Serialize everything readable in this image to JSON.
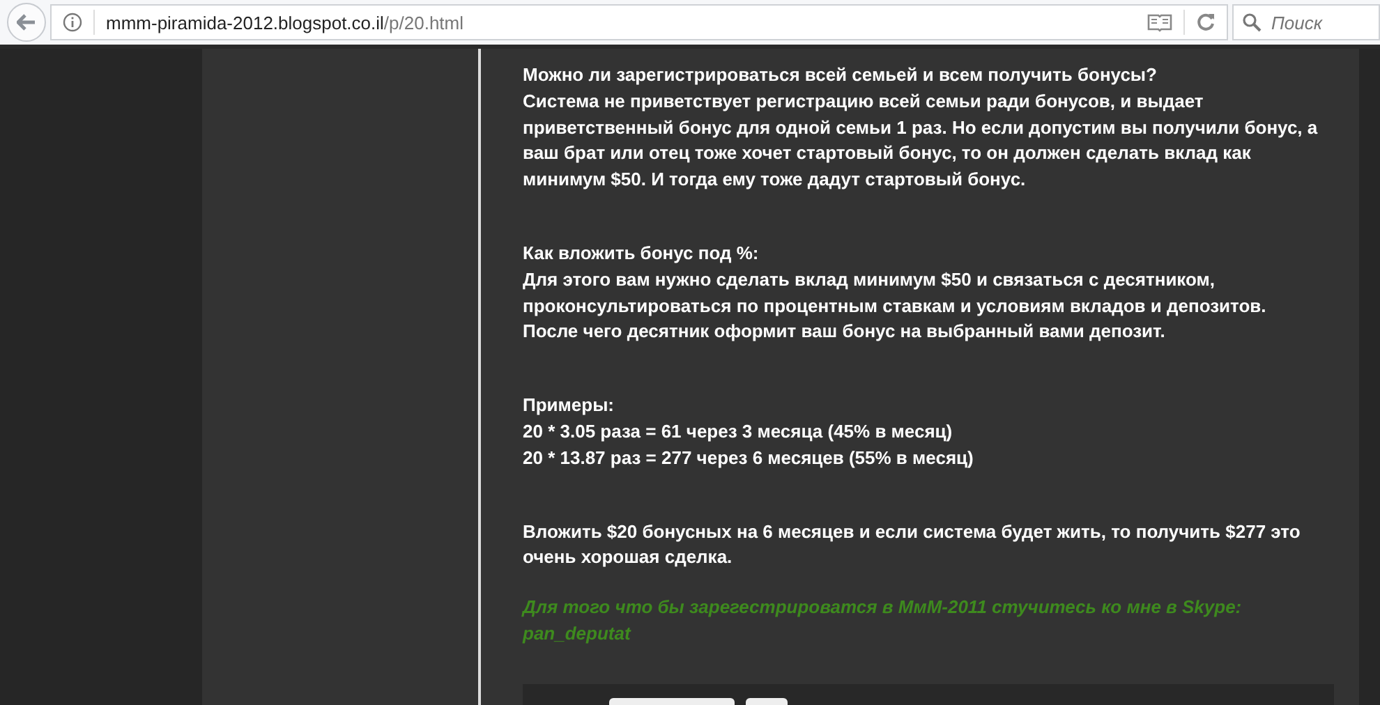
{
  "browser": {
    "url_host": "mmm-piramida-2012.blogspot.co.il",
    "url_path": "/p/20.html",
    "search": {
      "placeholder": "Поиск"
    }
  },
  "article": {
    "blocks": [
      {
        "kind": "text",
        "paragraphs": [
          "Можно ли зарегистрироваться всей семьей и всем получить бонусы?",
          "Система не приветствует регистрацию всей семьи ради бонусов, и выдает приветственный бонус для одной семьи 1 раз. Но если допустим вы получили бонус, а ваш брат или отец тоже хочет стартовый бонус, то он должен сделать вклад как минимум $50. И тогда ему тоже дадут стартовый бонус."
        ]
      },
      {
        "kind": "text",
        "paragraphs": [
          "Как вложить бонус под %:",
          "Для этого вам нужно сделать вклад минимум $50 и связаться с десятником, проконсультироваться по процентным ставкам и условиям вкладов и депозитов.",
          "После чего десятник оформит ваш бонус на выбранный вами депозит."
        ]
      },
      {
        "kind": "text",
        "paragraphs": [
          "Примеры:",
          "20 * 3.05 раза = 61 через 3 месяца (45% в месяц)",
          "20 * 13.87 раз = 277 через 6 месяцев (55% в месяц)"
        ]
      },
      {
        "kind": "text",
        "paragraphs": [
          "Вложить $20 бонусных на 6 месяцев и если система будет жить, то получить $277 это очень хорошая сделка."
        ]
      },
      {
        "kind": "highlight",
        "paragraphs": [
          "Для того что бы зарегестрироватся в МмМ-2011 стучитесь ко мне в Skype: pan_deputat"
        ]
      }
    ]
  }
}
